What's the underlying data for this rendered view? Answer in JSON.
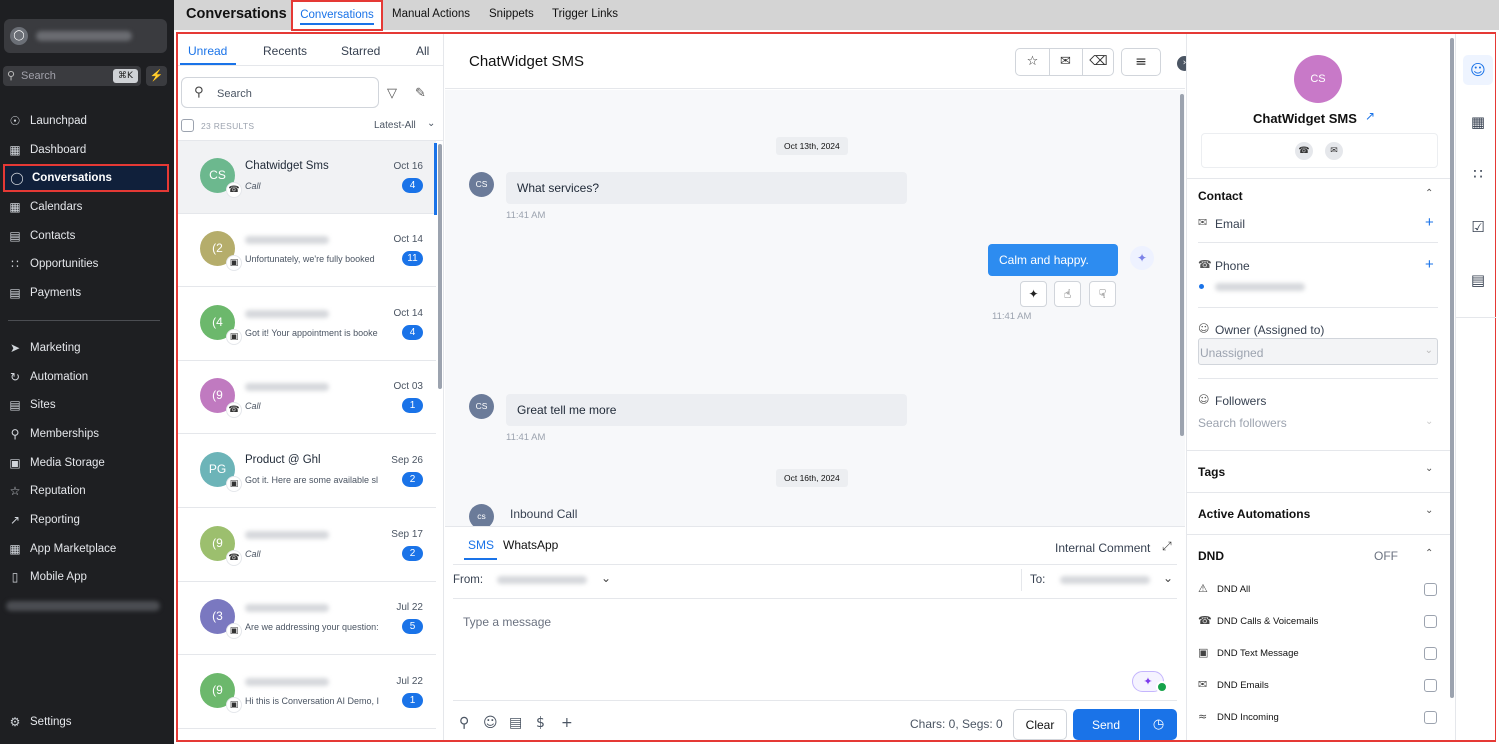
{
  "nav": {
    "account_icon": "user-circle-icon",
    "search_placeholder": "Search",
    "search_shortcut": "⌘K",
    "quick_action_icon": "bolt-icon",
    "items": [
      {
        "label": "Launchpad",
        "icon": "rocket-icon"
      },
      {
        "label": "Dashboard",
        "icon": "grid-icon"
      },
      {
        "label": "Conversations",
        "icon": "chat-bubble-icon",
        "active": true
      },
      {
        "label": "Calendars",
        "icon": "calendar-icon"
      },
      {
        "label": "Contacts",
        "icon": "contact-book-icon"
      },
      {
        "label": "Opportunities",
        "icon": "network-icon"
      },
      {
        "label": "Payments",
        "icon": "receipt-icon"
      },
      {
        "label": "Marketing",
        "icon": "send-icon"
      },
      {
        "label": "Automation",
        "icon": "automation-icon"
      },
      {
        "label": "Sites",
        "icon": "sites-icon"
      },
      {
        "label": "Memberships",
        "icon": "membership-icon"
      },
      {
        "label": "Media Storage",
        "icon": "image-icon"
      },
      {
        "label": "Reputation",
        "icon": "star-icon"
      },
      {
        "label": "Reporting",
        "icon": "trend-icon"
      },
      {
        "label": "App Marketplace",
        "icon": "apps-icon"
      },
      {
        "label": "Mobile App",
        "icon": "phone-device-icon"
      }
    ],
    "settings_label": "Settings"
  },
  "topbar": {
    "title": "Conversations",
    "tabs": [
      "Conversations",
      "Manual Actions",
      "Snippets",
      "Trigger Links"
    ],
    "active_tab": "Conversations"
  },
  "list": {
    "filter_tabs": [
      "Unread",
      "Recents",
      "Starred",
      "All"
    ],
    "active_filter": "Unread",
    "search_placeholder": "Search",
    "results": "23 RESULTS",
    "sort": "Latest-All",
    "conversations": [
      {
        "initials": "CS",
        "name": "Chatwidget Sms",
        "preview": "Call",
        "channel": "call",
        "date": "Oct 16",
        "badge": "4",
        "color": "#6cb88e",
        "selected": true
      },
      {
        "initials": "(2",
        "name": "",
        "preview": "Unfortunately, we're fully booked",
        "channel": "sms",
        "date": "Oct 14",
        "badge": "11",
        "color": "#b5ad6b"
      },
      {
        "initials": "(4",
        "name": "",
        "preview": "Got it! Your appointment is booke",
        "channel": "sms",
        "date": "Oct 14",
        "badge": "4",
        "color": "#6cb86c"
      },
      {
        "initials": "(9",
        "name": "",
        "preview": "Call",
        "channel": "call",
        "date": "Oct 03",
        "badge": "1",
        "color": "#c07ac0"
      },
      {
        "initials": "PG",
        "name": "Product @ Ghl",
        "preview": "Got it. Here are some available sl",
        "channel": "sms",
        "date": "Sep 26",
        "badge": "2",
        "color": "#6cb4b8"
      },
      {
        "initials": "(9",
        "name": "",
        "preview": "Call",
        "channel": "call",
        "date": "Sep 17",
        "badge": "2",
        "color": "#9cbf6e"
      },
      {
        "initials": "(3",
        "name": "",
        "preview": "Are we addressing your question:",
        "channel": "sms",
        "date": "Jul 22",
        "badge": "5",
        "color": "#7a78c0"
      },
      {
        "initials": "(9",
        "name": "",
        "preview": "Hi this is Conversation AI Demo, I",
        "channel": "sms",
        "date": "Jul 22",
        "badge": "1",
        "color": "#6cb86c"
      }
    ]
  },
  "chat": {
    "title": "ChatWidget SMS",
    "actions": [
      "star-icon",
      "mark-read-icon",
      "trash-icon"
    ],
    "filter_icon": "filter-lines-icon",
    "messages": {
      "date1": "Oct 13th, 2024",
      "in1_avatar": "CS",
      "in1_text": "What services?",
      "in1_time": "11:41 AM",
      "out1_text": "Calm and happy.",
      "out1_time": "11:41 AM",
      "in2_avatar": "CS",
      "in2_text": "Great tell me more",
      "in2_time": "11:41 AM",
      "date2": "Oct 16th, 2024",
      "in3_avatar": "cs",
      "in3_text": "Inbound Call"
    }
  },
  "composer": {
    "tabs": [
      "SMS",
      "WhatsApp"
    ],
    "active_tab": "SMS",
    "internal_comment": "Internal Comment",
    "from_label": "From:",
    "to_label": "To:",
    "placeholder": "Type a message",
    "counter": "Chars: 0, Segs: 0",
    "clear_label": "Clear",
    "send_label": "Send"
  },
  "contact": {
    "initials": "CS",
    "name": "ChatWidget SMS",
    "contact_section": "Contact",
    "email_label": "Email",
    "phone_label": "Phone",
    "owner_label": "Owner (Assigned to)",
    "owner_value": "Unassigned",
    "followers_label": "Followers",
    "followers_placeholder": "Search followers",
    "tags_label": "Tags",
    "automations_label": "Active Automations",
    "dnd_label": "DND",
    "dnd_state": "OFF",
    "dnd_items": [
      "DND All",
      "DND Calls & Voicemails",
      "DND Text Message",
      "DND Emails",
      "DND Incoming"
    ]
  },
  "rail": {
    "icons": [
      "contact-profile-icon",
      "calendar-icon",
      "opportunities-icon",
      "tasks-icon",
      "notes-icon"
    ],
    "active": "contact-profile-icon"
  },
  "colors": {
    "accent": "#1a73e8",
    "highlight_border": "#e53935",
    "nav_bg": "#1e1f22"
  }
}
